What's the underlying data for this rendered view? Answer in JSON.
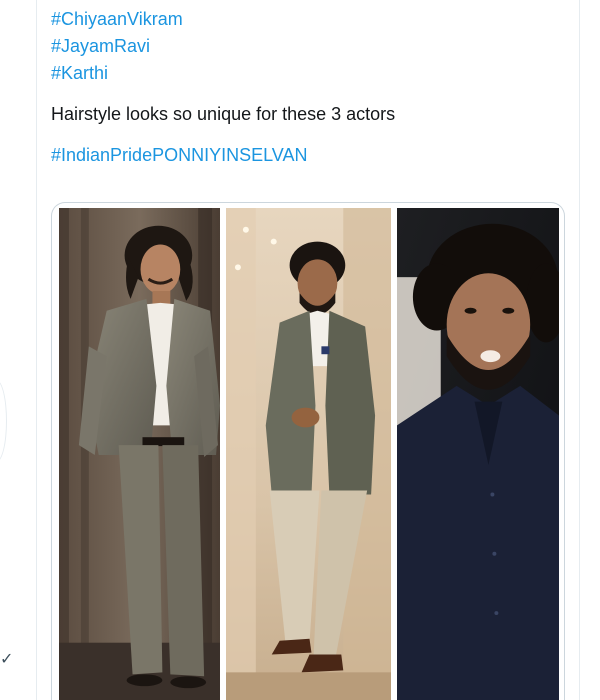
{
  "tweet": {
    "hashtags_top": [
      "#ChiyaanVikram",
      "#JayamRavi",
      "#Karthi"
    ],
    "body": "Hairstyle looks so unique for these 3 actors",
    "hashtag_bottom": "#IndianPridePONNIYINSELVAN"
  },
  "media": {
    "photos": [
      {
        "subject": "man in grey suit with long hair and mustache"
      },
      {
        "subject": "man in grey blazer and beige trousers leaning on wall"
      },
      {
        "subject": "man with curly hair and beard in dark shirt"
      }
    ]
  },
  "icons": {
    "left_partial": "chevron-icon"
  },
  "colors": {
    "link": "#1b95e0",
    "text": "#14171a",
    "border": "#e6ecf0",
    "media_border": "#ccd6dd"
  }
}
